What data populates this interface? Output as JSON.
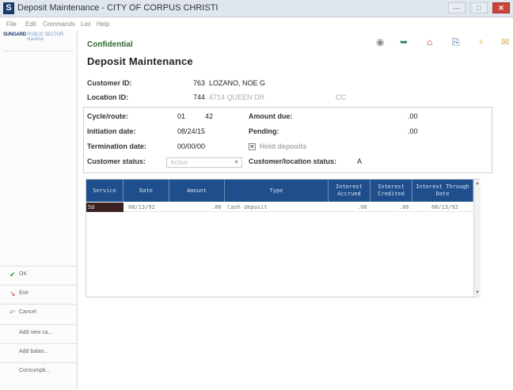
{
  "window": {
    "app_icon_letter": "S",
    "title": "Deposit Maintenance - CITY OF CORPUS CHRISTI",
    "controls": {
      "minimize": "—",
      "maximize": "□",
      "close": "✕"
    }
  },
  "menu": [
    "File",
    "Edit",
    "Commands",
    "List",
    "Help"
  ],
  "sidebar": {
    "logo_brand": "SUNGARD",
    "logo_suffix": "PUBLIC SECTOR",
    "logo_product": "Naviline",
    "buttons": [
      {
        "label": "OK",
        "icon": "check-icon"
      },
      {
        "label": "Exit",
        "icon": "exit-icon"
      },
      {
        "label": "Cancel",
        "icon": "cancel-icon"
      },
      {
        "label": "Add new ca...",
        "icon": ""
      },
      {
        "label": "Add balan...",
        "icon": ""
      },
      {
        "label": "Consumpti...",
        "icon": ""
      }
    ]
  },
  "toolbar_icons": [
    "help-globe-icon",
    "refresh-arrow-icon",
    "home-icon",
    "document-arrow-icon",
    "lightbulb-icon",
    "mail-icon"
  ],
  "header": {
    "confidential": "Confidential",
    "title": "Deposit Maintenance"
  },
  "customer": {
    "customer_id_label": "Customer ID:",
    "customer_id_value": "763",
    "customer_name": "LOZANO, NOE G",
    "location_id_label": "Location ID:",
    "location_id_value": "744",
    "location_address": "4714 QUEEN DR",
    "location_suffix": "CC"
  },
  "details": {
    "cycle_route_label": "Cycle/route:",
    "cycle_value": "01",
    "route_value": "42",
    "initiation_label": "Initiation date:",
    "initiation_value": "08/24/15",
    "termination_label": "Termination date:",
    "termination_value": "00/00/00",
    "customer_status_label": "Customer status:",
    "customer_status_value": "Active",
    "amount_due_label": "Amount due:",
    "amount_due_value": ".00",
    "pending_label": "Pending:",
    "pending_value": ".00",
    "hold_deposits_label": "Hold deposits",
    "hold_deposits_checked": "✕",
    "cust_loc_status_label": "Customer/location status:",
    "cust_loc_status_value": "A"
  },
  "grid": {
    "columns": [
      "Service",
      "Date",
      "Amount",
      "Type",
      "Interest Accrued",
      "Interest Credited",
      "Interest Through Date"
    ],
    "rows": [
      {
        "service": "SU",
        "date": "08/13/92",
        "amount": ".00",
        "type": "Cash deposit",
        "interest_accrued": ".00",
        "interest_credited": ".00",
        "interest_through": "08/13/92"
      }
    ]
  }
}
